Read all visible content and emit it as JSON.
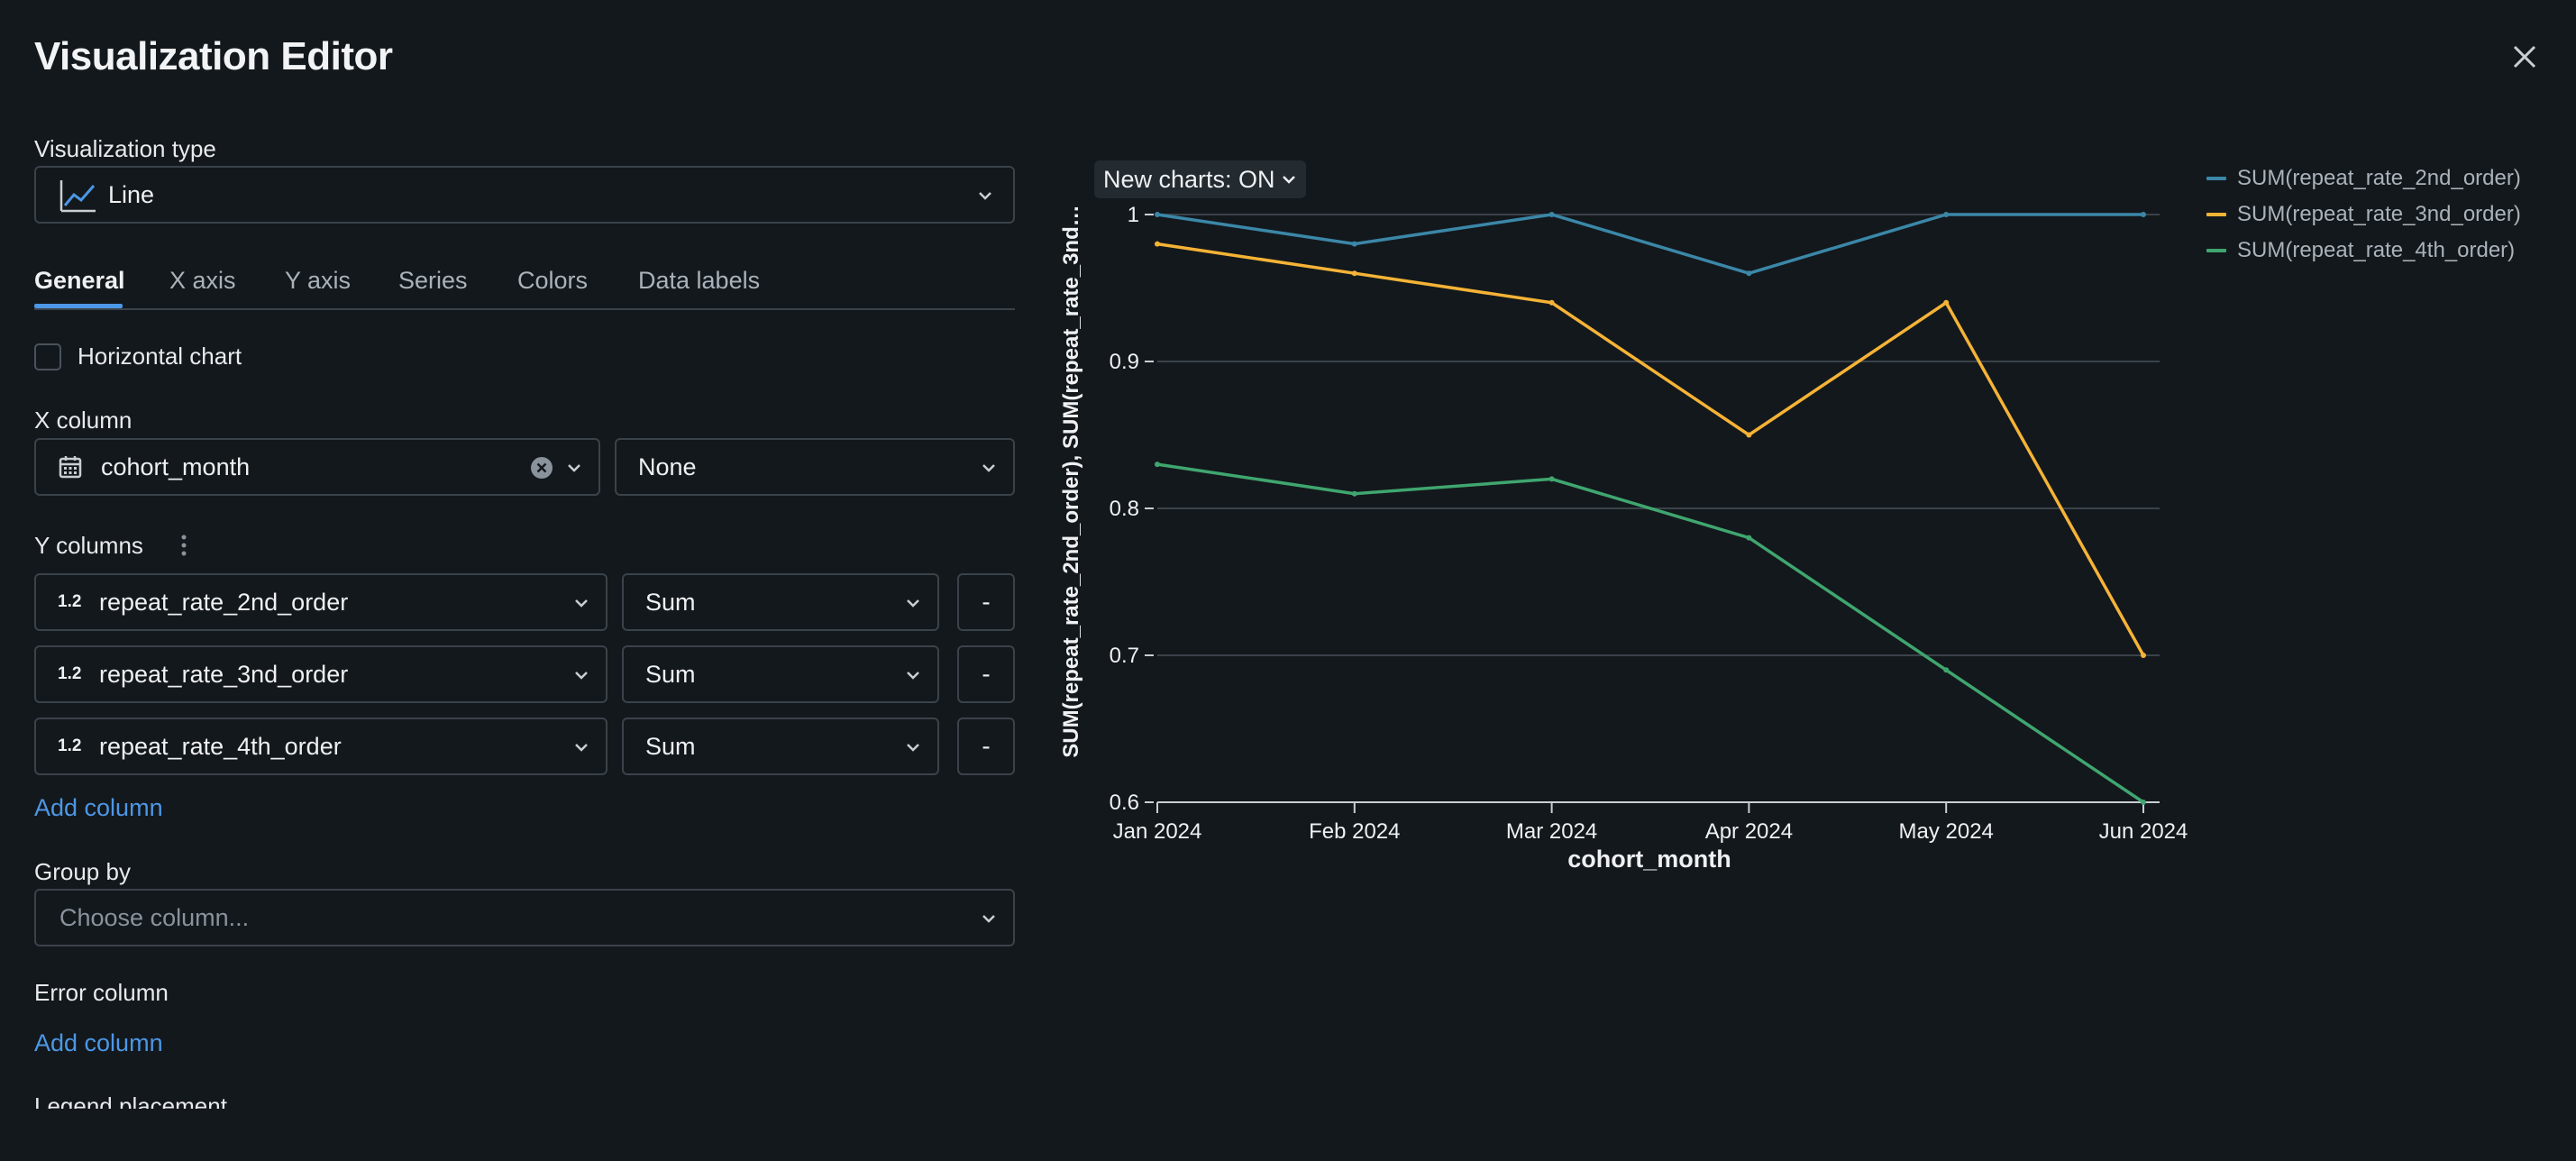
{
  "window": {
    "title": "Visualization Editor"
  },
  "viz_type": {
    "label": "Visualization type",
    "value": "Line"
  },
  "tabs": [
    {
      "label": "General",
      "active": true
    },
    {
      "label": "X axis"
    },
    {
      "label": "Y axis"
    },
    {
      "label": "Series"
    },
    {
      "label": "Colors"
    },
    {
      "label": "Data labels"
    }
  ],
  "horizontal_chart": {
    "label": "Horizontal chart",
    "checked": false
  },
  "x_column": {
    "label": "X column",
    "value": "cohort_month",
    "scale": "None"
  },
  "y_columns": {
    "label": "Y columns",
    "rows": [
      {
        "type": "1.2",
        "column": "repeat_rate_2nd_order",
        "agg": "Sum",
        "remove": "-"
      },
      {
        "type": "1.2",
        "column": "repeat_rate_3nd_order",
        "agg": "Sum",
        "remove": "-"
      },
      {
        "type": "1.2",
        "column": "repeat_rate_4th_order",
        "agg": "Sum",
        "remove": "-"
      }
    ],
    "add_label": "Add column"
  },
  "group_by": {
    "label": "Group by",
    "placeholder": "Choose column..."
  },
  "error_column": {
    "label": "Error column",
    "add_label": "Add column"
  },
  "legend_placement": {
    "label": "Legend placement"
  },
  "new_charts_toggle": "New charts: ON",
  "chart_data": {
    "type": "line",
    "categories": [
      "Jan 2024",
      "Feb 2024",
      "Mar 2024",
      "Apr 2024",
      "May 2024",
      "Jun 2024"
    ],
    "series": [
      {
        "name": "SUM(repeat_rate_2nd_order)",
        "color": "#3b87a8",
        "values": [
          1.0,
          0.98,
          1.0,
          0.96,
          1.0,
          1.0
        ]
      },
      {
        "name": "SUM(repeat_rate_3nd_order)",
        "color": "#f5b336",
        "values": [
          0.98,
          0.96,
          0.94,
          0.85,
          0.94,
          0.7
        ]
      },
      {
        "name": "SUM(repeat_rate_4th_order)",
        "color": "#3fa66f",
        "values": [
          0.83,
          0.81,
          0.82,
          0.78,
          0.69,
          0.6
        ]
      }
    ],
    "xlabel": "cohort_month",
    "ylabel": "SUM(repeat_rate_2nd_order), SUM(repeat_rate_3nd…",
    "ylim": [
      0.6,
      1.0
    ],
    "yticks": [
      "0.6",
      "0.7",
      "0.8",
      "0.9",
      "1"
    ],
    "grid": true,
    "legend_position": "top-right"
  }
}
